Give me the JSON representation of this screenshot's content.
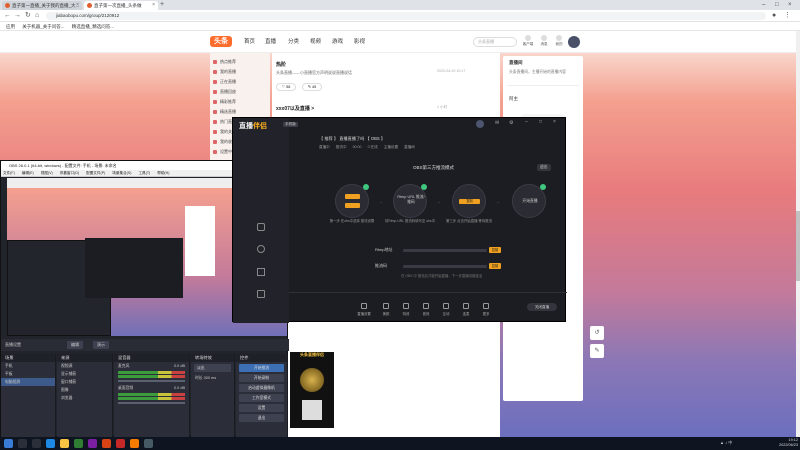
{
  "browser": {
    "tabs": [
      {
        "title": "直子第一直播_关于我的直播_大...",
        "active": false
      },
      {
        "title": "直子第一次直播_头条做",
        "active": true
      }
    ],
    "url": "jiabaobopu.com/group/2120912",
    "bookmarks": [
      "应用",
      "关于机器_关于问答...",
      "精选直播_精选问答..."
    ]
  },
  "site": {
    "logo": "头条",
    "nav": [
      "首页",
      "直播",
      "分类",
      "视频",
      "游戏",
      "影视"
    ],
    "search_placeholder": "头条直播",
    "top_icons": [
      "客户端",
      "消息",
      "我的"
    ],
    "left_menu": [
      "热点推荐",
      "我的直播",
      "正在直播",
      "直播回放",
      "精彩推荐",
      "精选直播",
      "热门直播",
      "我的关注",
      "我的收藏",
      "设置中心"
    ],
    "feed": [
      {
        "title": "热阶",
        "desc": "头条直播——小直播官方声明说说直播说话",
        "meta": "2020-04-19 10:17",
        "likes": "58",
        "comments": "45"
      },
      {
        "title": "xxx07以及直播 >",
        "desc": "",
        "meta": "1 小时",
        "likes": "",
        "comments": ""
      }
    ],
    "right_card": {
      "title": "直播间",
      "desc": "头条直播间，主播开始的直播内容",
      "user": "阿主"
    }
  },
  "obs": {
    "title": "OBS 26.0.1 (64-bit, windows) - 配置文件: 手机 - 场景: 未命名",
    "menu": [
      "文件(F)",
      "编辑(E)",
      "视图(V)",
      "停靠窗口(D)",
      "配置文件(P)",
      "场景集合(S)",
      "工具(T)",
      "帮助(H)"
    ],
    "controls": [
      "直播设置",
      "编辑",
      "演示"
    ],
    "scenes_header": "场景",
    "scenes": [
      "手机",
      "平板",
      "电脑投屏"
    ],
    "sources_header": "来源",
    "sources": [
      "视频源",
      "显示捕获",
      "窗口捕获",
      "图像",
      "浏览器"
    ],
    "mixer_header": "混音器",
    "mixer": [
      {
        "name": "麦克风",
        "db": "0.0 dB"
      },
      {
        "name": "桌面音频",
        "db": "0.0 dB"
      }
    ],
    "transitions_header": "转场特效",
    "transition": "淡出",
    "duration_label": "时长",
    "duration": "300 ms",
    "controls_header": "控件",
    "control_buttons": [
      "开始推流",
      "开始录制",
      "启动虚拟摄像机",
      "工作室模式",
      "设置",
      "退出"
    ]
  },
  "app": {
    "logo_pre": "直播",
    "logo_brand": "伴侣",
    "tag": "手机版",
    "header": "【 推荐 】 直播直播了吗 【 OBS 】",
    "modes": [
      "直播中",
      "推流中",
      "00:00",
      "0 在线",
      "主播设置",
      "直播间"
    ],
    "title": "OBS第三方推流模式",
    "exit": "退出",
    "steps": [
      {
        "label": "第一步",
        "text": "第一步 在obs中选择 推流设置"
      },
      {
        "label": "Rtmp URL 推流/推码",
        "text": "将Rtmp URL 推流码填写至 obs中"
      },
      {
        "label": "复制",
        "text": "第三步 点击开始直播 等待推流"
      },
      {
        "label": "开始直播",
        "text": "开始直播"
      }
    ],
    "sliders": [
      {
        "label": "Rtmp地址",
        "btn": "复制"
      },
      {
        "label": "推流码",
        "btn": "复制"
      }
    ],
    "hint": "在 OBS 中 推流后才能开始直播，下一步直播将被激活",
    "toolbar": [
      "直播设置",
      "美颜",
      "特效",
      "音效",
      "互动",
      "连麦",
      "更多"
    ],
    "close": "关闭直播"
  },
  "poster_title": "头条直播伴侣",
  "taskbar": {
    "time": "19:12",
    "date": "2022/06/23",
    "lang": "中"
  },
  "colors": {
    "accent": "#f0a020",
    "site_brand": "#ff6d2d",
    "obs_select": "#3c6fb4"
  }
}
